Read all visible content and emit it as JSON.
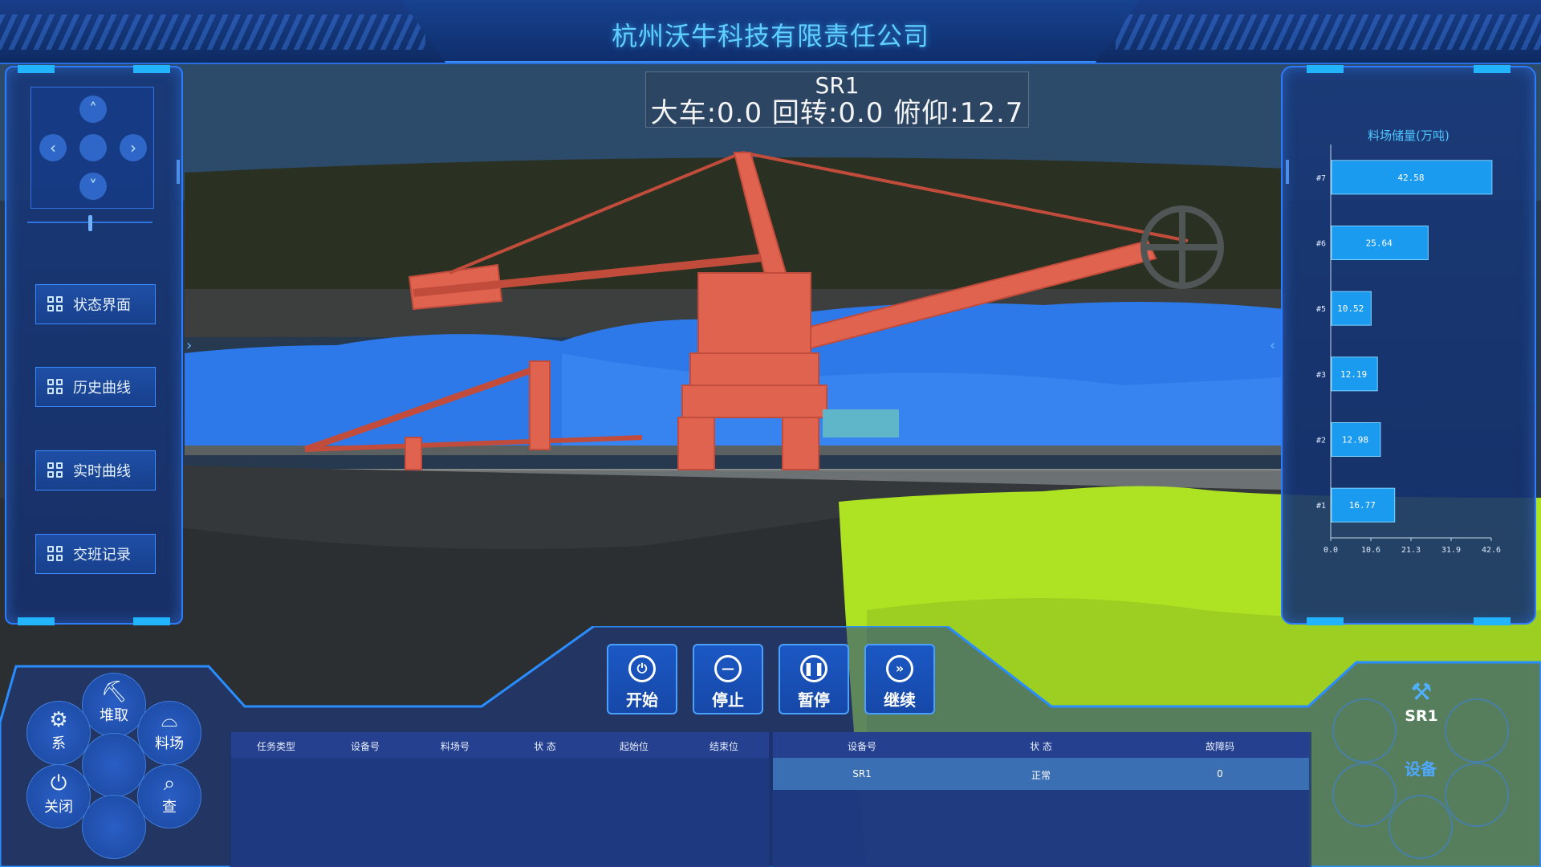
{
  "header": {
    "title": "杭州沃牛科技有限责任公司"
  },
  "machine": {
    "name": "SR1",
    "params_text": "大车:0.0 回转:0.0 俯仰:12.7"
  },
  "left_menu": {
    "items": [
      {
        "label": "状态界面"
      },
      {
        "label": "历史曲线"
      },
      {
        "label": "实时曲线"
      },
      {
        "label": "交班记录"
      }
    ]
  },
  "controls": {
    "start": "开始",
    "stop": "停止",
    "pause": "暂停",
    "continue": "继续"
  },
  "hex_menu": {
    "stack": "堆取",
    "system": "系",
    "yard": "料场",
    "close": "关闭",
    "query": "查"
  },
  "device_ring": {
    "device": "SR1",
    "label": "设备"
  },
  "task_table": {
    "headers": [
      "任务类型",
      "设备号",
      "料场号",
      "状  态",
      "起始位",
      "结束位"
    ]
  },
  "device_table": {
    "headers": [
      "设备号",
      "状  态",
      "故障码"
    ],
    "rows": [
      {
        "device": "SR1",
        "status": "正常",
        "fault": "0"
      }
    ]
  },
  "chart_data": {
    "type": "bar",
    "orientation": "horizontal",
    "title": "料场储量(万吨)",
    "categories": [
      "#7",
      "#6",
      "#5",
      "#3",
      "#2",
      "#1"
    ],
    "values": [
      42.58,
      25.64,
      10.52,
      12.19,
      12.98,
      16.77
    ],
    "xticks": [
      "0.0",
      "10.6",
      "21.3",
      "31.9",
      "42.6"
    ],
    "xlim": [
      0,
      42.6
    ],
    "color": "#1a9bef"
  },
  "colors": {
    "accent": "#2d7bff",
    "title": "#5fd0ff",
    "machine": "#e0634f",
    "pile_blue": "#2f7df0",
    "pile_green": "#b5e82a"
  }
}
